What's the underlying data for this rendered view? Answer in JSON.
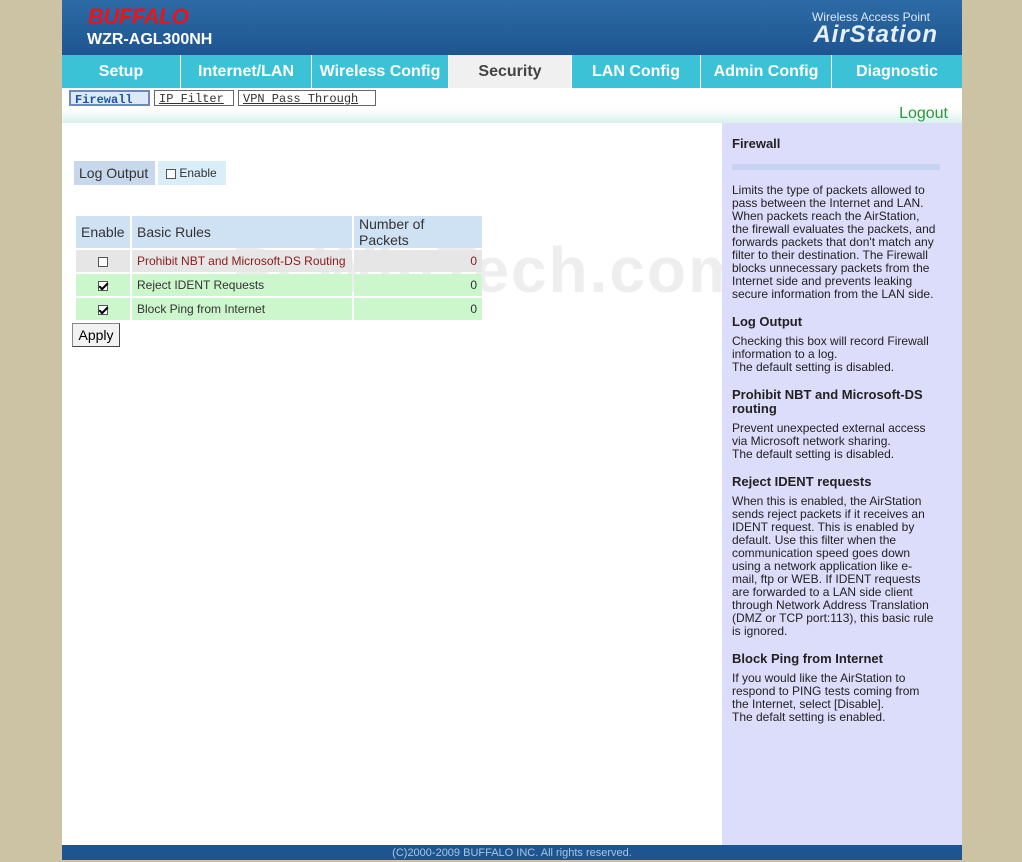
{
  "header": {
    "logo": "BUFFALO",
    "model": "WZR-AGL300NH",
    "brand_sub": "Wireless Access Point",
    "brand_main": "AirStation"
  },
  "tabs": [
    {
      "label": "Setup"
    },
    {
      "label": "Internet/LAN"
    },
    {
      "label": "Wireless Config"
    },
    {
      "label": "Security",
      "active": true
    },
    {
      "label": "LAN Config"
    },
    {
      "label": "Admin Config"
    },
    {
      "label": "Diagnostic"
    }
  ],
  "subtabs": [
    {
      "label": "Firewall",
      "active": true
    },
    {
      "label": "IP Filter"
    },
    {
      "label": "VPN Pass Through"
    }
  ],
  "logout": "Logout",
  "log_output": {
    "label": "Log Output",
    "checkbox_label": "Enable",
    "checked": false
  },
  "table": {
    "headers": [
      "Enable",
      "Basic Rules",
      "Number of Packets"
    ],
    "rows": [
      {
        "rule": "Prohibit NBT and Microsoft-DS Routing",
        "packets": "0",
        "checked": false
      },
      {
        "rule": "Reject IDENT Requests",
        "packets": "0",
        "checked": true
      },
      {
        "rule": "Block Ping from Internet",
        "packets": "0",
        "checked": true
      }
    ]
  },
  "apply_label": "Apply",
  "watermark": "PcWinTech.com",
  "help": {
    "title": "Firewall",
    "intro": "Limits the type of packets allowed to pass between the Internet and LAN. When packets reach the AirStation, the firewall evaluates the packets, and forwards packets that don't match any filter to their destination. The Firewall blocks unnecessary packets from the Internet side and prevents leaking secure information from the LAN side.",
    "sections": [
      {
        "title": "Log Output",
        "text": "Checking this box will record Firewall information to a log.",
        "text2": "The default setting is disabled."
      },
      {
        "title": "Prohibit NBT and Microsoft-DS routing",
        "text": "Prevent unexpected external access via Microsoft network sharing.",
        "text2": "The default setting is disabled."
      },
      {
        "title": "Reject IDENT requests",
        "text": "When this is enabled, the AirStation sends reject packets if it receives an IDENT request. This is enabled by default. Use this filter when the communication speed goes down using a network application like e-mail, ftp or WEB. If IDENT requests are forwarded to a LAN side client through Network Address Translation (DMZ or TCP port:113), this basic rule is ignored.",
        "text2": ""
      },
      {
        "title": "Block Ping from Internet",
        "text": "If you would like the AirStation to respond to PING tests coming from the Internet, select [Disable].",
        "text2": "The defalt setting is enabled."
      }
    ]
  },
  "footer": "(C)2000-2009 BUFFALO INC. All rights reserved."
}
